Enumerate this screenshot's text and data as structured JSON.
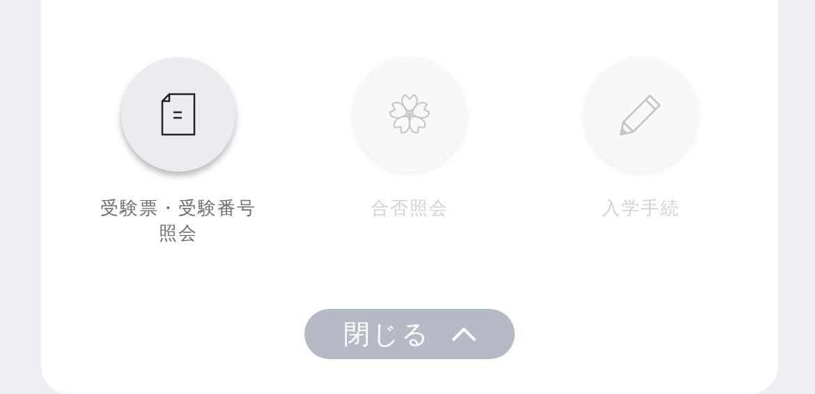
{
  "menu_items": [
    {
      "kind": "document",
      "label": "受験票・受験番号照会",
      "disabled": false
    },
    {
      "kind": "flower",
      "label": "合否照会",
      "disabled": true
    },
    {
      "kind": "pencil",
      "label": "入学手続",
      "disabled": true
    }
  ],
  "close_button": {
    "label": "閉じる"
  }
}
